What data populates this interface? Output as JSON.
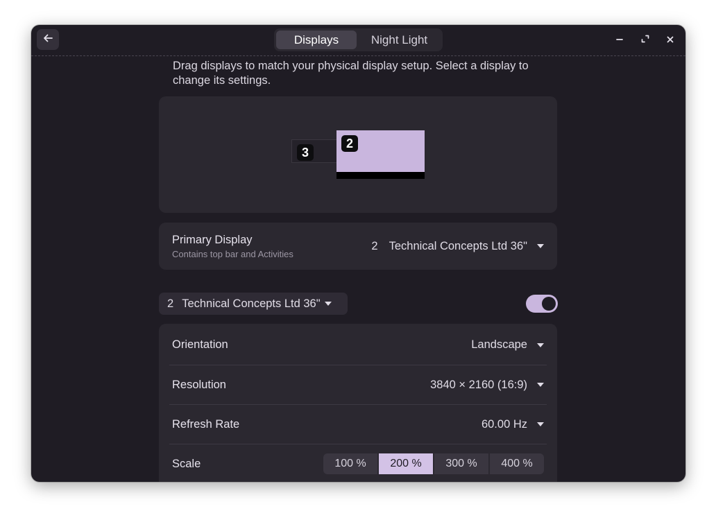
{
  "header": {
    "tabs": [
      {
        "label": "Displays",
        "active": true
      },
      {
        "label": "Night Light",
        "active": false
      }
    ]
  },
  "intro": "Drag displays to match your physical display setup. Select a display to change its settings.",
  "arrangement": {
    "monitors": [
      {
        "number": "3"
      },
      {
        "number": "2",
        "selected": true
      }
    ]
  },
  "primary_display": {
    "title": "Primary Display",
    "subtitle": "Contains top bar and Activities",
    "value_number": "2",
    "value_name": "Technical Concepts Ltd 36\""
  },
  "monitor_select": {
    "number": "2",
    "name": "Technical Concepts Ltd 36\"",
    "enabled": true
  },
  "settings": {
    "orientation": {
      "label": "Orientation",
      "value": "Landscape"
    },
    "resolution": {
      "label": "Resolution",
      "value": "3840 × 2160 (16:9)"
    },
    "refresh_rate": {
      "label": "Refresh Rate",
      "value": "60.00 Hz"
    },
    "scale": {
      "label": "Scale",
      "options": [
        "100 %",
        "200 %",
        "300 %",
        "400 %"
      ],
      "selected": "200 %"
    }
  },
  "colors": {
    "accent": "#c9b6de",
    "window_bg": "#1f1c24",
    "card_bg": "#2b2830"
  }
}
